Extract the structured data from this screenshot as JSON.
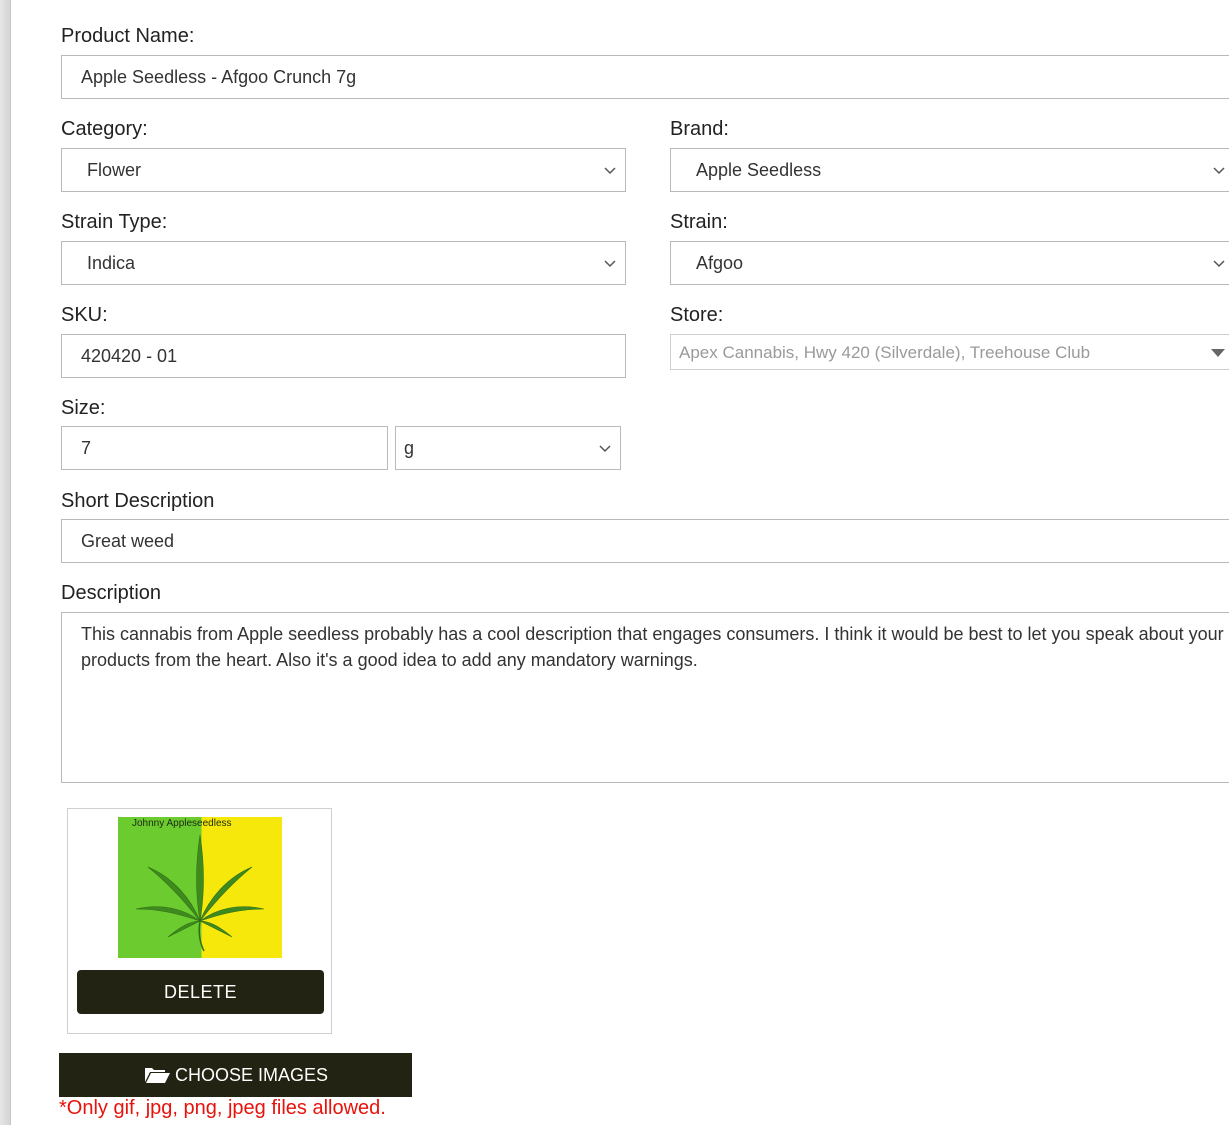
{
  "form": {
    "product_name": {
      "label": "Product Name:",
      "value": "Apple Seedless - Afgoo Crunch 7g"
    },
    "category": {
      "label": "Category:",
      "value": "Flower"
    },
    "brand": {
      "label": "Brand:",
      "value": "Apple Seedless"
    },
    "strain_type": {
      "label": "Strain Type:",
      "value": "Indica"
    },
    "strain": {
      "label": "Strain:",
      "value": "Afgoo"
    },
    "sku": {
      "label": "SKU:",
      "value": "420420 - 01"
    },
    "store": {
      "label": "Store:",
      "value": "Apex Cannabis, Hwy 420 (Silverdale), Treehouse Club"
    },
    "size": {
      "label": "Size:",
      "value": "7",
      "unit": "g"
    },
    "short_description": {
      "label": "Short Description",
      "value": "Great weed"
    },
    "description": {
      "label": "Description",
      "value": "This cannabis from Apple seedless probably has a cool description that engages consumers. I think it would be best to let you speak about your products from the heart. Also it's a good idea to add any mandatory warnings."
    }
  },
  "image": {
    "caption": "Johnny Appleseedless",
    "delete_label": "DELETE",
    "colors": {
      "left": "#6ccb2f",
      "right": "#f6e80b",
      "leaf": "#3f8a1f"
    }
  },
  "upload": {
    "button_label": "CHOOSE IMAGES",
    "icon": "folder-open-icon",
    "note": "*Only gif, jpg, png, jpeg files allowed."
  },
  "theme": {
    "button_bg": "#222313",
    "warning": "#e8120c"
  }
}
